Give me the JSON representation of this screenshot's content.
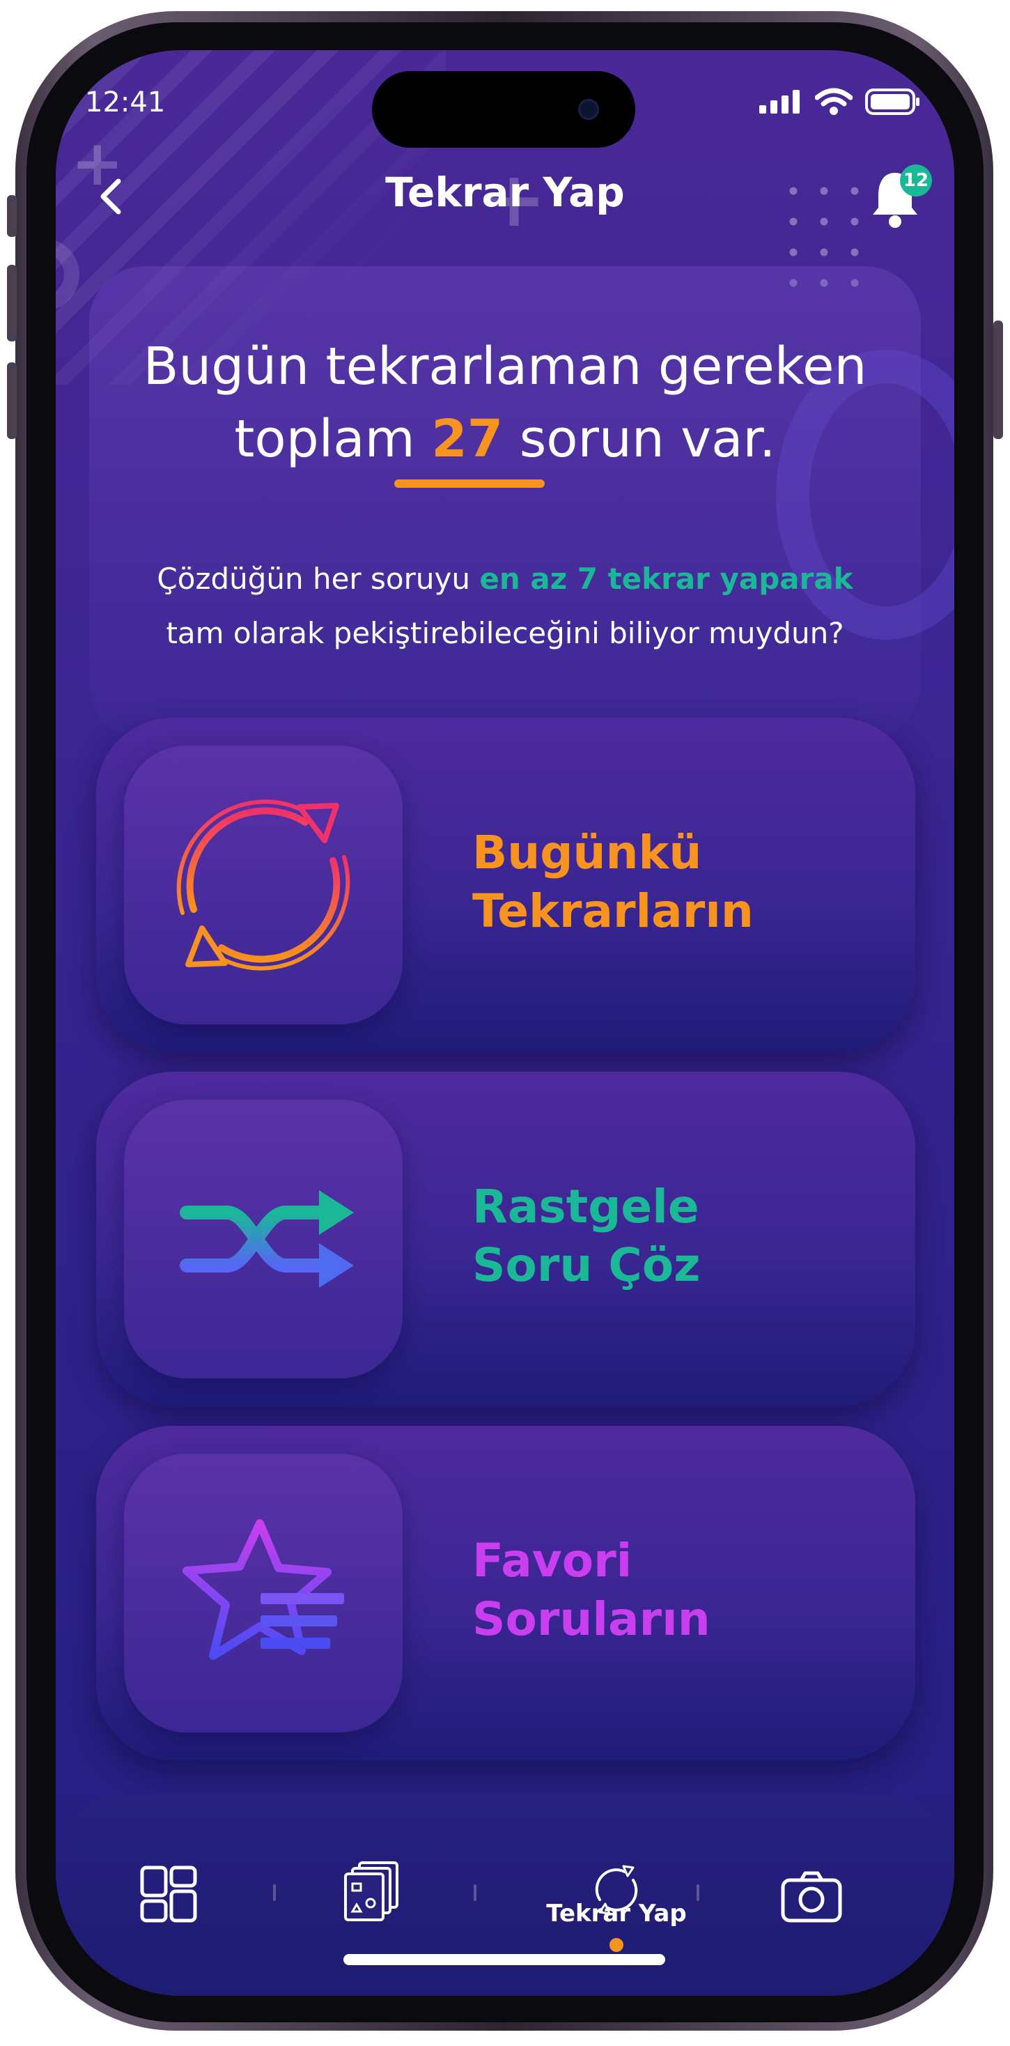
{
  "status_bar": {
    "time": "12:41"
  },
  "header": {
    "title": "Tekrar Yap",
    "notification_count": "12"
  },
  "intro": {
    "line1": "Bugün tekrarlaman gereken",
    "line2_prefix": "toplam ",
    "count": "27",
    "line2_suffix": " sorun var.",
    "sub_prefix": "Çözdüğün her soruyu ",
    "sub_highlight": "en az 7 tekrar yaparak",
    "sub_line2": "tam olarak pekiştirebileceğini biliyor muydun?"
  },
  "menu": [
    {
      "line1": "Bugünkü",
      "line2": "Tekrarların",
      "color": "#f7931e",
      "icon": "refresh-cycle-icon"
    },
    {
      "line1": "Rastgele",
      "line2": "Soru Çöz",
      "color": "#1bb897",
      "icon": "shuffle-icon"
    },
    {
      "line1": "Favori",
      "line2": "Soruların",
      "color": "#c93ff0",
      "icon": "star-list-icon"
    }
  ],
  "bottom_nav": {
    "items": [
      "dashboard-icon",
      "question-cards-icon",
      "review-icon",
      "camera-icon"
    ],
    "active_label": "Tekrar Yap"
  },
  "colors": {
    "accent_orange": "#f7931e",
    "accent_green": "#1bb897",
    "accent_purple": "#c93ff0"
  }
}
